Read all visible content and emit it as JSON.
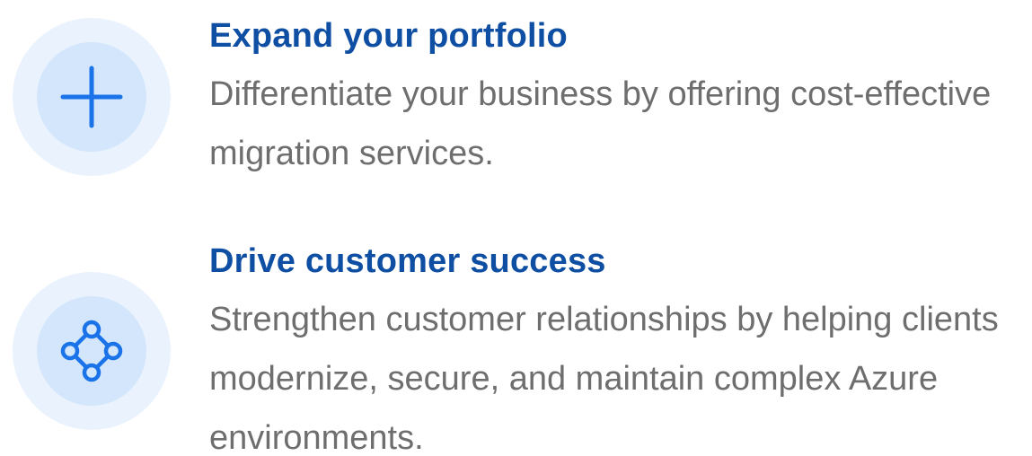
{
  "colors": {
    "title": "#0f4fa3",
    "description": "#6e6e6e",
    "icon_outer_ring": "#eaf3fd",
    "icon_inner_circle": "#d3e6fc",
    "icon_stroke": "#1a73e8"
  },
  "features": [
    {
      "icon": "plus-icon",
      "title": "Expand your portfolio",
      "description": "Differentiate your business by offering cost-effective migration services."
    },
    {
      "icon": "network-nodes-icon",
      "title": "Drive customer success",
      "description": "Strengthen customer relationships by helping clients modernize, secure, and maintain complex Azure environments."
    }
  ]
}
